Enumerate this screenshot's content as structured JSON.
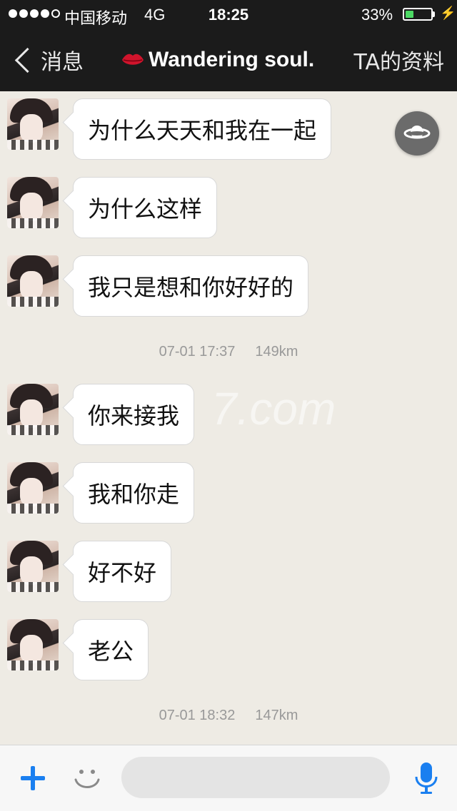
{
  "status_bar": {
    "carrier": "中国移动",
    "network": "4G",
    "time": "18:25",
    "battery_percent": "33%",
    "battery_level": 0.33,
    "signal_bars": 4,
    "signal_max": 5
  },
  "nav": {
    "back_label": "消息",
    "title": "Wandering soul.",
    "title_icon": "lips-icon",
    "profile_link": "TA的资料"
  },
  "messages": [
    {
      "text": "为什么天天和我在一起"
    },
    {
      "text": "为什么这样"
    },
    {
      "text": "我只是想和你好好的"
    },
    {
      "text": "你来接我"
    },
    {
      "text": "我和你走"
    },
    {
      "text": "好不好"
    },
    {
      "text": "老公"
    }
  ],
  "timestamps": [
    {
      "time": "07-01 17:37",
      "distance": "149km"
    },
    {
      "time": "07-01 18:32",
      "distance": "147km"
    }
  ],
  "watermark": "7.com",
  "input_bar": {
    "plus_icon": "plus-icon",
    "emoji_icon": "emoji-icon",
    "mic_icon": "microphone-icon",
    "placeholder": ""
  },
  "colors": {
    "accent": "#1a7ff0",
    "bar_background": "#1b1b1b",
    "chat_background": "#eeebe4"
  }
}
